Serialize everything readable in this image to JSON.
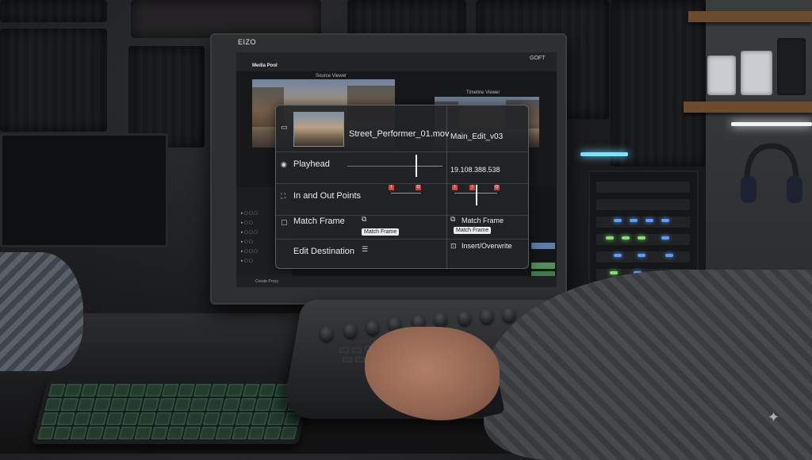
{
  "monitor": {
    "brand": "EIZO",
    "app_title": "Media Pool",
    "top_right_label": "GOFT"
  },
  "viewers": {
    "source_label": "Source Viewer",
    "timeline_label": "Timeline Viewer"
  },
  "overlay": {
    "rows": [
      {
        "label": "Street_Performer_01.mov",
        "right_text": "Main_Edit_v03"
      },
      {
        "label": "Playhead",
        "right_text": "19.108.388.538"
      },
      {
        "label": "In and Out Points",
        "right_text": ""
      },
      {
        "label": "Match Frame",
        "right_text": "Match Frame",
        "tooltip_left": "Match Frame",
        "tooltip_right": "Match Frame"
      },
      {
        "label": "Edit Destination",
        "right_text": "Insert/Overwrite"
      }
    ],
    "playhead_progress": 0.72
  },
  "bottom_bar": {
    "left_label": "Create Proxy"
  },
  "icons": {
    "playhead": "play-circle-icon",
    "in_out": "bracket-icon",
    "match_frame": "match-frame-icon",
    "edit_destination": "edit-destination-icon",
    "insert_overwrite": "insert-overwrite-icon"
  },
  "colors": {
    "accent_red": "#d94a3f",
    "overlay_bg": "#222427",
    "led_green": "#7ee36a",
    "led_blue": "#5a9dff"
  }
}
